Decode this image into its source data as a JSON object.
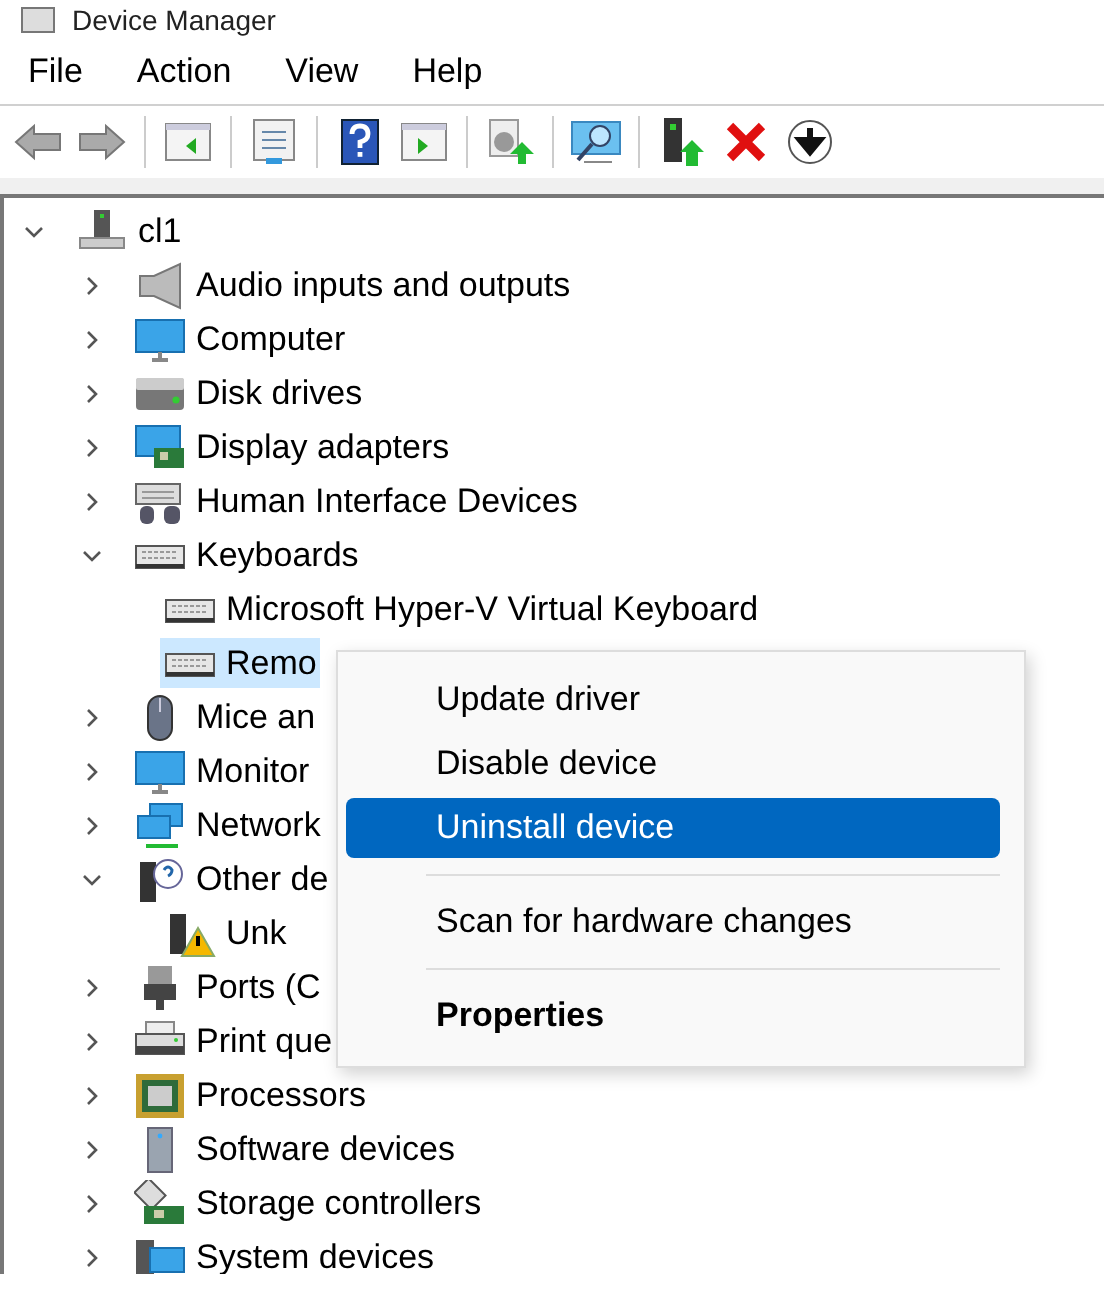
{
  "window": {
    "title": "Device Manager"
  },
  "menu_bar": [
    {
      "label": "File"
    },
    {
      "label": "Action"
    },
    {
      "label": "View"
    },
    {
      "label": "Help"
    }
  ],
  "tree": [
    {
      "label": "cl1",
      "kind": "host",
      "expanded": true,
      "selected": false,
      "children": [
        {
          "label": "Audio inputs and outputs",
          "kind": "speaker",
          "expanded": false,
          "selected": false
        },
        {
          "label": "Computer",
          "kind": "monitor",
          "expanded": false,
          "selected": false
        },
        {
          "label": "Disk drives",
          "kind": "drive",
          "expanded": false,
          "selected": false
        },
        {
          "label": "Display adapters",
          "kind": "adapter",
          "expanded": false,
          "selected": false
        },
        {
          "label": "Human Interface Devices",
          "kind": "hid",
          "expanded": false,
          "selected": false
        },
        {
          "label": "Keyboards",
          "kind": "keyboard",
          "expanded": true,
          "selected": false,
          "children": [
            {
              "label": "Microsoft Hyper-V Virtual Keyboard",
              "kind": "keyboard",
              "selected": false
            },
            {
              "label": "Remo",
              "kind": "keyboard",
              "selected": true
            }
          ]
        },
        {
          "label": "Mice an",
          "kind": "mouse",
          "expanded": false,
          "selected": false
        },
        {
          "label": "Monitor",
          "kind": "monitor",
          "expanded": false,
          "selected": false
        },
        {
          "label": "Network",
          "kind": "network",
          "expanded": false,
          "selected": false
        },
        {
          "label": "Other de",
          "kind": "unknown",
          "expanded": true,
          "selected": false,
          "children": [
            {
              "label": "Unk",
              "kind": "warning",
              "selected": false
            }
          ]
        },
        {
          "label": "Ports (C",
          "kind": "port",
          "expanded": false,
          "selected": false
        },
        {
          "label": "Print que",
          "kind": "printer",
          "expanded": false,
          "selected": false
        },
        {
          "label": "Processors",
          "kind": "chip",
          "expanded": false,
          "selected": false
        },
        {
          "label": "Software devices",
          "kind": "software",
          "expanded": false,
          "selected": false
        },
        {
          "label": "Storage controllers",
          "kind": "storage",
          "expanded": false,
          "selected": false
        },
        {
          "label": "System devices",
          "kind": "system",
          "expanded": false,
          "selected": false
        }
      ]
    }
  ],
  "context_menu": [
    {
      "kind": "item",
      "label": "Update driver",
      "selected": false
    },
    {
      "kind": "item",
      "label": "Disable device",
      "selected": false
    },
    {
      "kind": "item",
      "label": "Uninstall device",
      "selected": true
    },
    {
      "kind": "separator"
    },
    {
      "kind": "item",
      "label": "Scan for hardware changes",
      "selected": false
    },
    {
      "kind": "separator"
    },
    {
      "kind": "default",
      "label": "Properties",
      "selected": false
    }
  ]
}
